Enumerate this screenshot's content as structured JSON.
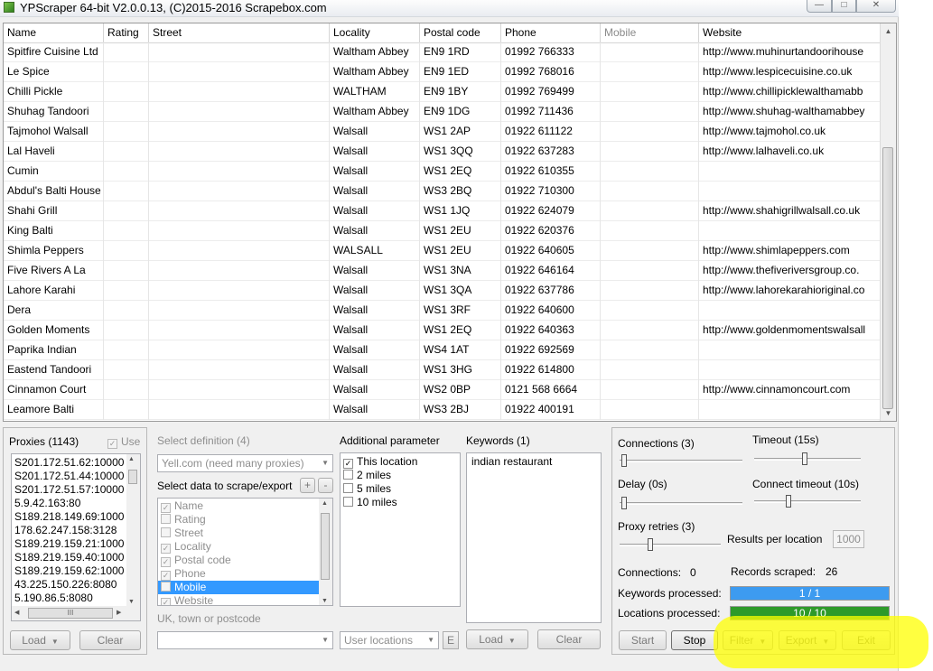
{
  "window": {
    "title": "YPScraper 64-bit V2.0.0.13, (C)2015-2016 Scrapebox.com",
    "controls": {
      "minimize": "—",
      "maximize": "□",
      "close": "✕"
    }
  },
  "grid": {
    "columns": [
      "Name",
      "Rating",
      "Street",
      "Locality",
      "Postal code",
      "Phone",
      "Mobile",
      "Website"
    ],
    "rows": [
      [
        "Spitfire Cuisine Ltd",
        "",
        "",
        "Waltham Abbey",
        "EN9 1RD",
        "01992 766333",
        "",
        "http://www.muhinurtandoorihouse"
      ],
      [
        "Le Spice",
        "",
        "",
        "Waltham Abbey",
        "EN9 1ED",
        "01992 768016",
        "",
        "http://www.lespicecuisine.co.uk"
      ],
      [
        "Chilli Pickle",
        "",
        "",
        "WALTHAM",
        "EN9 1BY",
        "01992 769499",
        "",
        "http://www.chillipicklewalthamabb"
      ],
      [
        "Shuhag Tandoori",
        "",
        "",
        "Waltham Abbey",
        "EN9 1DG",
        "01992 711436",
        "",
        "http://www.shuhag-walthamabbey"
      ],
      [
        "Tajmohol Walsall",
        "",
        "",
        "Walsall",
        "WS1 2AP",
        "01922 611122",
        "",
        "http://www.tajmohol.co.uk"
      ],
      [
        "Lal Haveli",
        "",
        "",
        "Walsall",
        "WS1 3QQ",
        "01922 637283",
        "",
        "http://www.lalhaveli.co.uk"
      ],
      [
        "Cumin",
        "",
        "",
        "Walsall",
        "WS1 2EQ",
        "01922 610355",
        "",
        ""
      ],
      [
        "Abdul's Balti House",
        "",
        "",
        "Walsall",
        "WS3 2BQ",
        "01922 710300",
        "",
        ""
      ],
      [
        "Shahi Grill",
        "",
        "",
        "Walsall",
        "WS1 1JQ",
        "01922 624079",
        "",
        "http://www.shahigrillwalsall.co.uk"
      ],
      [
        "King Balti",
        "",
        "",
        "Walsall",
        "WS1 2EU",
        "01922 620376",
        "",
        ""
      ],
      [
        "Shimla Peppers",
        "",
        "",
        "WALSALL",
        "WS1 2EU",
        "01922 640605",
        "",
        "http://www.shimlapeppers.com"
      ],
      [
        "Five Rivers A La",
        "",
        "",
        "Walsall",
        "WS1 3NA",
        "01922 646164",
        "",
        "http://www.thefiveriversgroup.co."
      ],
      [
        "Lahore Karahi",
        "",
        "",
        "Walsall",
        "WS1 3QA",
        "01922 637786",
        "",
        "http://www.lahorekarahioriginal.co"
      ],
      [
        "Dera",
        "",
        "",
        "Walsall",
        "WS1 3RF",
        "01922 640600",
        "",
        ""
      ],
      [
        "Golden Moments",
        "",
        "",
        "Walsall",
        "WS1 2EQ",
        "01922 640363",
        "",
        "http://www.goldenmomentswalsall"
      ],
      [
        "Paprika Indian",
        "",
        "",
        "Walsall",
        "WS4 1AT",
        "01922 692569",
        "",
        ""
      ],
      [
        "Eastend Tandoori",
        "",
        "",
        "Walsall",
        "WS1 3HG",
        "01922 614800",
        "",
        ""
      ],
      [
        "Cinnamon Court",
        "",
        "",
        "Walsall",
        "WS2 0BP",
        "0121 568 6664",
        "",
        "http://www.cinnamoncourt.com"
      ],
      [
        "Leamore Balti",
        "",
        "",
        "Walsall",
        "WS3 2BJ",
        "01922 400191",
        "",
        ""
      ]
    ]
  },
  "proxies": {
    "title": "Proxies (1143)",
    "use_label": "Use",
    "items": [
      "S201.172.51.62:10000",
      "S201.172.51.44:10000",
      "S201.172.51.57:10000",
      "5.9.42.163:80",
      "S189.218.149.69:1000",
      "178.62.247.158:3128",
      "S189.219.159.21:1000",
      "S189.219.159.40:1000",
      "S189.219.159.62:1000",
      "43.225.150.226:8080",
      "5.190.86.5:8080"
    ],
    "load_label": "Load",
    "clear_label": "Clear",
    "hscroll_grip": "III"
  },
  "definition": {
    "title": "Select definition (4)",
    "combo_value": "Yell.com (need many proxies)",
    "scrape_title": "Select data to scrape/export",
    "plus": "+",
    "minus": "-",
    "fields": [
      "Name",
      "Rating",
      "Street",
      "Locality",
      "Postal code",
      "Phone",
      "Mobile",
      "Website"
    ],
    "checked": [
      true,
      false,
      false,
      true,
      true,
      true,
      false,
      true
    ],
    "selected_field": "Mobile",
    "location_placeholder": "UK, town or postcode",
    "user_locations": "User locations",
    "e_button": "E"
  },
  "additional": {
    "title": "Additional parameter",
    "options": [
      "This location",
      "2 miles",
      "5 miles",
      "10 miles"
    ],
    "checked": [
      true,
      false,
      false,
      false
    ]
  },
  "keywords": {
    "title": "Keywords (1)",
    "items": [
      "indian restaurant"
    ],
    "load_label": "Load",
    "clear_label": "Clear"
  },
  "settings": {
    "connections_label": "Connections (3)",
    "timeout_label": "Timeout (15s)",
    "delay_label": "Delay (0s)",
    "connect_timeout_label": "Connect timeout (10s)",
    "proxy_retries_label": "Proxy retries (3)",
    "results_per_location_label": "Results per location",
    "results_per_location_value": "1000"
  },
  "status": {
    "connections_label": "Connections:",
    "connections_value": "0",
    "records_label": "Records scraped:",
    "records_value": "26",
    "keywords_label": "Keywords processed:",
    "keywords_value": "1 / 1",
    "keywords_progress": 1.0,
    "locations_label": "Locations processed:",
    "locations_value": "10 / 10",
    "locations_progress": 1.0
  },
  "actions": {
    "start": "Start",
    "stop": "Stop",
    "filter": "Filter",
    "export": "Export",
    "exit": "Exit"
  },
  "colors": {
    "keywords_bar": "#3d9bf0",
    "locations_bar": "#2e9a2a",
    "selection": "#3399ff",
    "annotation_highlight": "#ffff00"
  }
}
